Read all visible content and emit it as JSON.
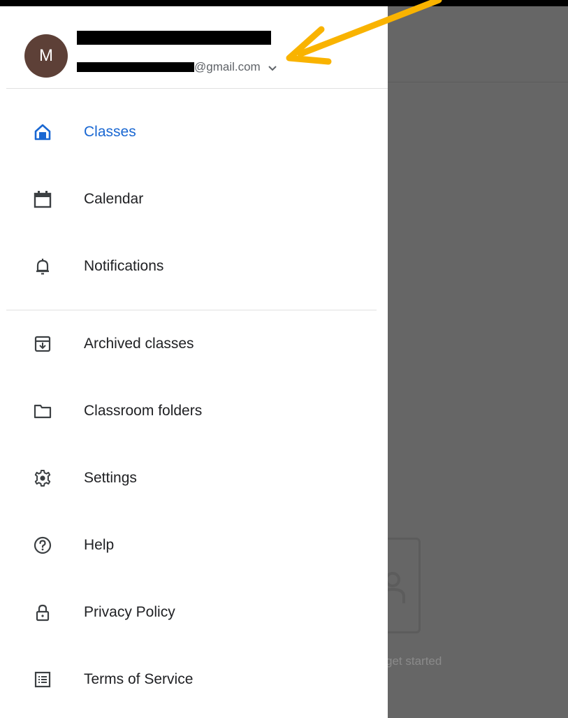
{
  "account": {
    "avatar_letter": "M",
    "email_domain": "@gmail.com"
  },
  "nav": {
    "primary": [
      {
        "label": "Classes",
        "icon": "home-icon",
        "active": true
      },
      {
        "label": "Calendar",
        "icon": "calendar-icon"
      },
      {
        "label": "Notifications",
        "icon": "bell-icon"
      }
    ],
    "secondary": [
      {
        "label": "Archived classes",
        "icon": "archive-icon"
      },
      {
        "label": "Classroom folders",
        "icon": "folder-icon"
      },
      {
        "label": "Settings",
        "icon": "gear-icon"
      },
      {
        "label": "Help",
        "icon": "help-icon"
      },
      {
        "label": "Privacy Policy",
        "icon": "lock-icon"
      },
      {
        "label": "Terms of Service",
        "icon": "document-list-icon"
      }
    ]
  },
  "background": {
    "hint_text": "get started"
  },
  "colors": {
    "accent": "#1967d2",
    "avatar": "#5d4037",
    "annotation_arrow": "#f9b300",
    "scrim": "#666666"
  }
}
